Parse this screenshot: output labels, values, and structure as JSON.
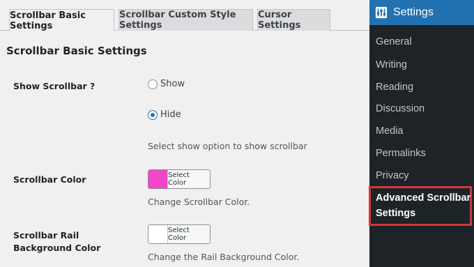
{
  "tabs": [
    {
      "label": "Scrollbar Basic Settings",
      "active": true
    },
    {
      "label": "Scrollbar Custom Style Settings",
      "active": false
    },
    {
      "label": "Cursor Settings",
      "active": false
    }
  ],
  "section_title": "Scrollbar Basic Settings",
  "show_scrollbar": {
    "label": "Show Scrollbar ?",
    "options": [
      "Show",
      "Hide"
    ],
    "selected": "Hide",
    "description": "Select show option to show scrollbar"
  },
  "scrollbar_color": {
    "label": "Scrollbar Color",
    "button_label": "Select Color",
    "swatch": "#f046c8",
    "description": "Change Scrollbar Color."
  },
  "rail_color": {
    "label": "Scrollbar Rail Background Color",
    "button_label": "Select Color",
    "swatch": "#ffffff",
    "description": "Change the Rail Background Color."
  },
  "admin_menu": {
    "title": "Settings",
    "icon": "wp-settings-icon",
    "items": [
      "General",
      "Writing",
      "Reading",
      "Discussion",
      "Media",
      "Permalinks",
      "Privacy"
    ],
    "current": "Advanced Scrollbar Settings",
    "accent": "#2271b1",
    "highlight_color": "#d63638"
  }
}
